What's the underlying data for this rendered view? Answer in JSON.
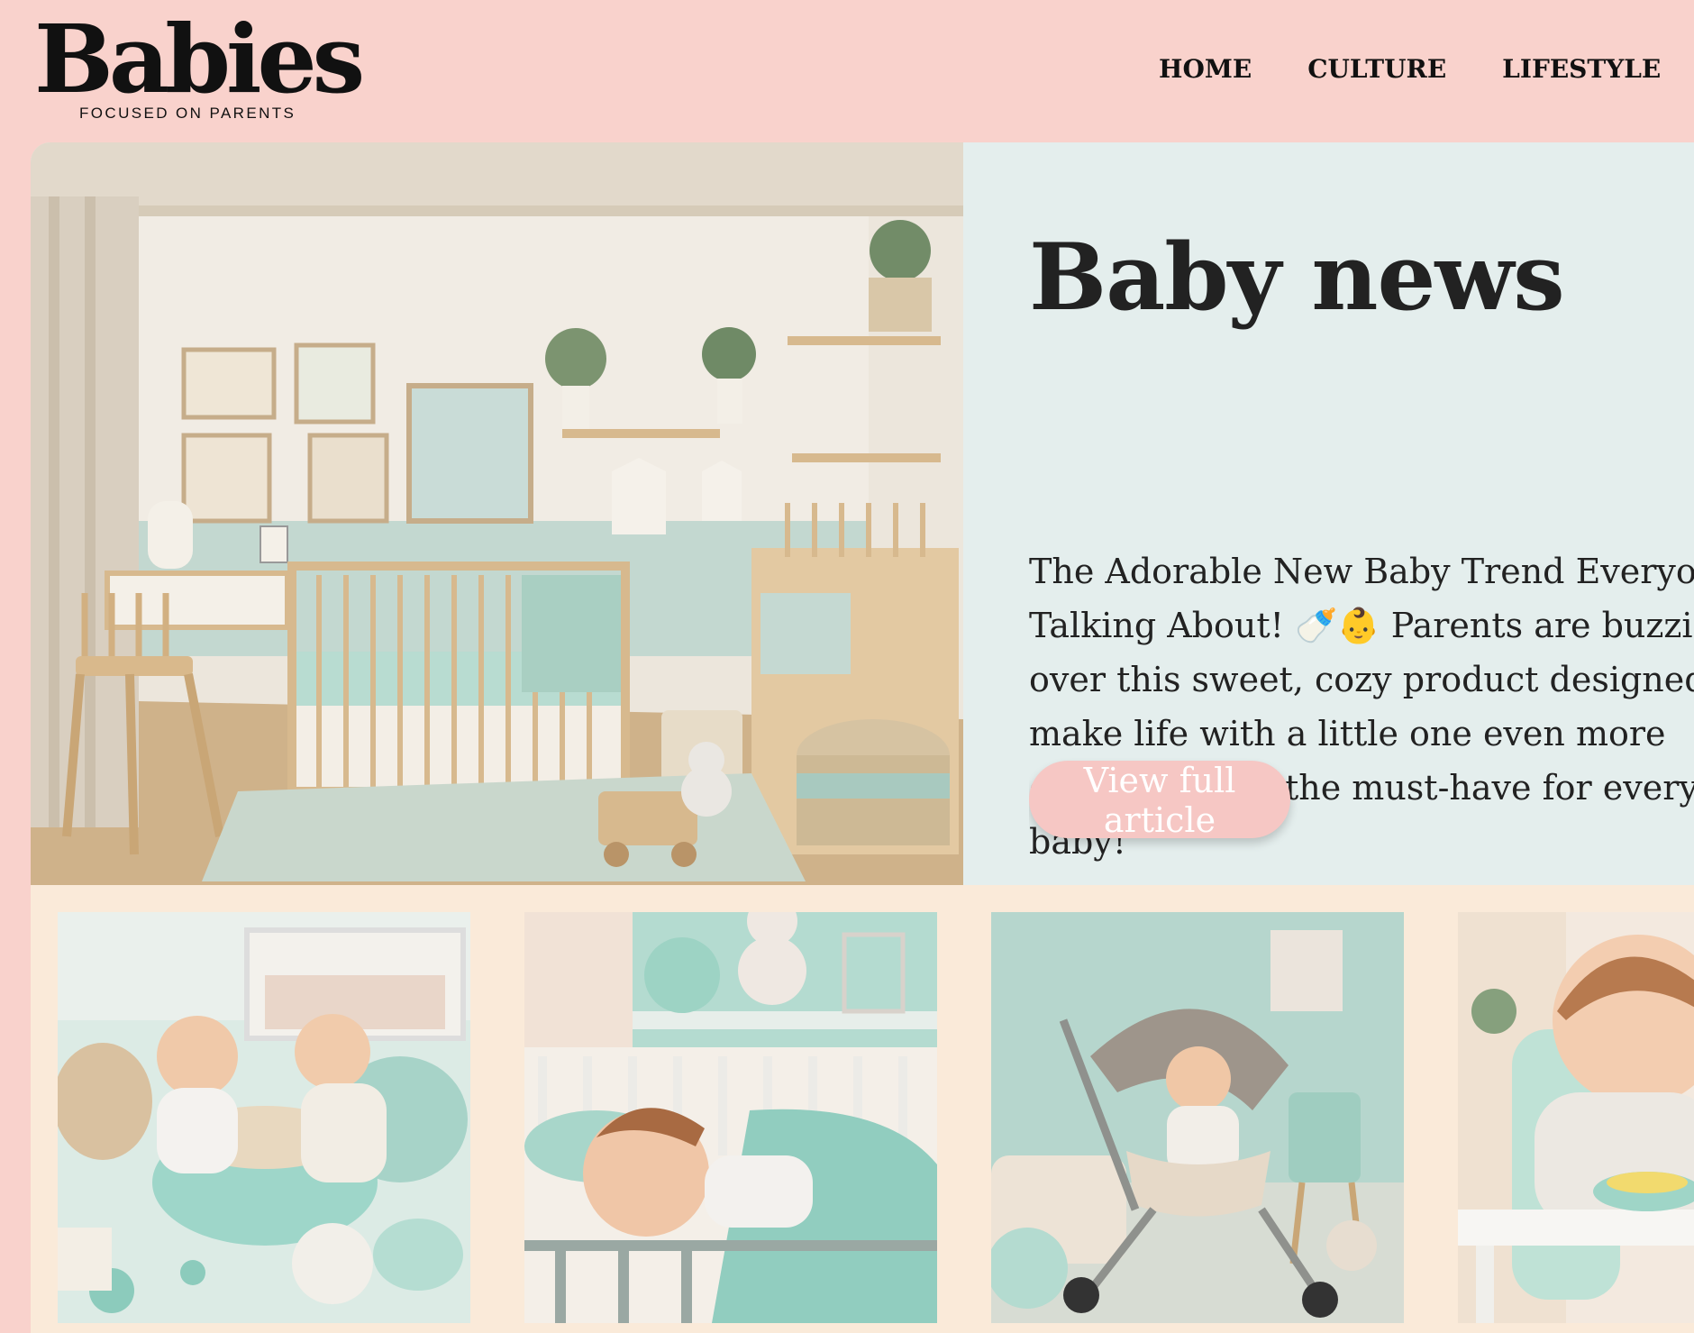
{
  "brand": {
    "title": "Babies",
    "tagline": "FOCUSED ON PARENTS"
  },
  "nav": {
    "items": [
      {
        "label": "HOME"
      },
      {
        "label": "CULTURE"
      },
      {
        "label": "LIFESTYLE"
      }
    ]
  },
  "hero": {
    "title": "Baby news",
    "text": "The Adorable New Baby Trend Everyone’s Talking About! 🍼👶 Parents are buzzing over this sweet, cozy product designed to make life with a little one even more delightful. It’s the must-have for every stylish baby!",
    "cta_label": "View full article"
  },
  "colors": {
    "header_bg": "#f9d2cc",
    "hero_bg": "#e4eeed",
    "gallery_bg": "#faead9",
    "button_bg": "#f6c7c4",
    "accent_mint": "#9ed6c9"
  }
}
